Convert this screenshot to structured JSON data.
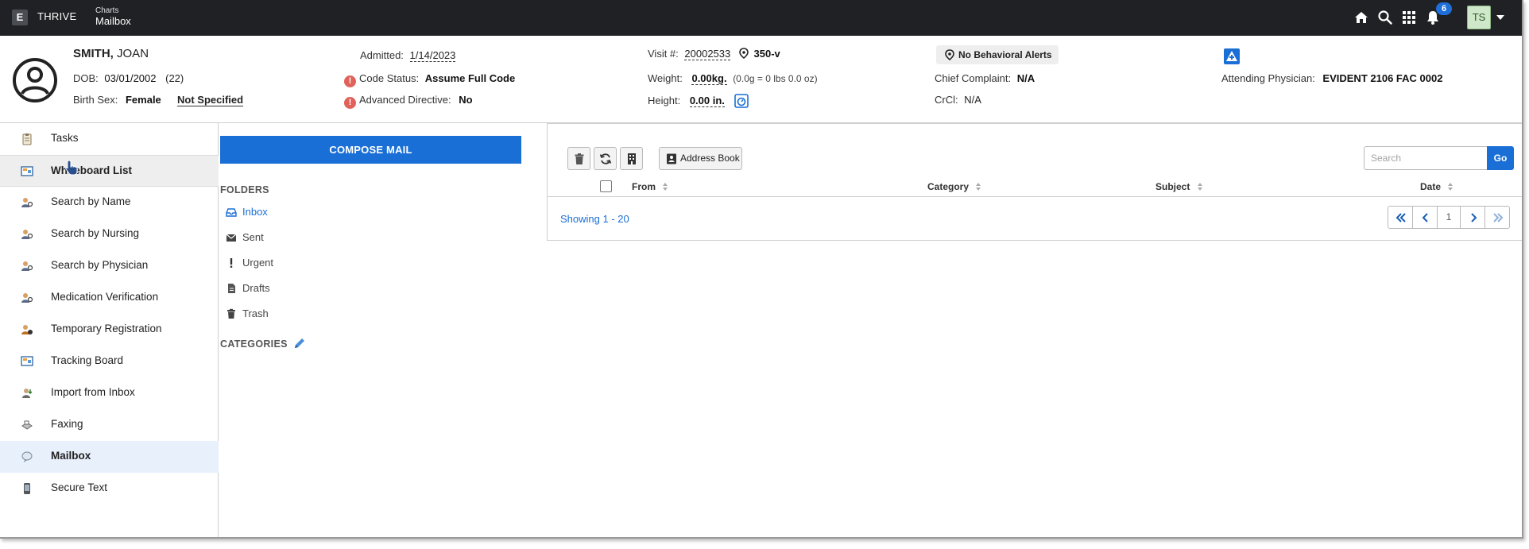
{
  "topbar": {
    "brand": "THRIVE",
    "breadcrumb_parent": "Charts",
    "breadcrumb_current": "Mailbox",
    "notification_count": "6",
    "user_initials": "TS"
  },
  "patient": {
    "last_name": "SMITH,",
    "first_name": "JOAN",
    "dob_label": "DOB:",
    "dob": "03/01/2002",
    "age": "(22)",
    "birth_sex_label": "Birth Sex:",
    "birth_sex": "Female",
    "gender_identity": "Not Specified",
    "admitted_label": "Admitted:",
    "admitted": "1/14/2023",
    "code_status_label": "Code Status:",
    "code_status": "Assume Full Code",
    "advanced_directive_label": "Advanced Directive:",
    "advanced_directive": "No",
    "visit_label": "Visit #:",
    "visit_number": "20002533",
    "location": "350-v",
    "weight_label": "Weight:",
    "weight": "0.00kg.",
    "weight_detail": "(0.0g = 0 lbs 0.0 oz)",
    "height_label": "Height:",
    "height": "0.00 in.",
    "behavioral_alerts": "No Behavioral Alerts",
    "chief_complaint_label": "Chief Complaint:",
    "chief_complaint": "N/A",
    "crcl_label": "CrCl:",
    "crcl": "N/A",
    "attending_label": "Attending Physician:",
    "attending": "EVIDENT 2106 FAC 0002"
  },
  "sidebar": {
    "items": [
      {
        "label": "Tasks",
        "icon": "clipboard-icon"
      },
      {
        "label": "Whiteboard List",
        "icon": "whiteboard-icon"
      },
      {
        "label": "Search by Name",
        "icon": "person-search-icon"
      },
      {
        "label": "Search by Nursing",
        "icon": "person-search-icon"
      },
      {
        "label": "Search by Physician",
        "icon": "person-search-icon"
      },
      {
        "label": "Medication Verification",
        "icon": "person-search-icon"
      },
      {
        "label": "Temporary Registration",
        "icon": "person-add-icon"
      },
      {
        "label": "Tracking Board",
        "icon": "whiteboard-icon"
      },
      {
        "label": "Import from Inbox",
        "icon": "import-icon"
      },
      {
        "label": "Faxing",
        "icon": "fax-icon"
      },
      {
        "label": "Mailbox",
        "icon": "mailbox-icon"
      },
      {
        "label": "Secure Text",
        "icon": "phone-icon"
      }
    ]
  },
  "mail": {
    "compose_label": "COMPOSE MAIL",
    "folders_heading": "FOLDERS",
    "folders": [
      {
        "label": "Inbox",
        "icon": "inbox-icon"
      },
      {
        "label": "Sent",
        "icon": "envelope-icon"
      },
      {
        "label": "Urgent",
        "icon": "exclamation-icon"
      },
      {
        "label": "Drafts",
        "icon": "document-icon"
      },
      {
        "label": "Trash",
        "icon": "trash-icon"
      }
    ],
    "categories_heading": "CATEGORIES",
    "address_book_label": "Address Book",
    "search_placeholder": "Search",
    "go_label": "Go",
    "columns": {
      "from": "From",
      "category": "Category",
      "subject": "Subject",
      "date": "Date"
    },
    "showing": "Showing 1 - 20",
    "current_page": "1"
  },
  "colors": {
    "accent": "#1a6fd6",
    "topbar": "#1f2124",
    "warning": "#e0625a",
    "avatar_bg": "#cfe8c9"
  }
}
